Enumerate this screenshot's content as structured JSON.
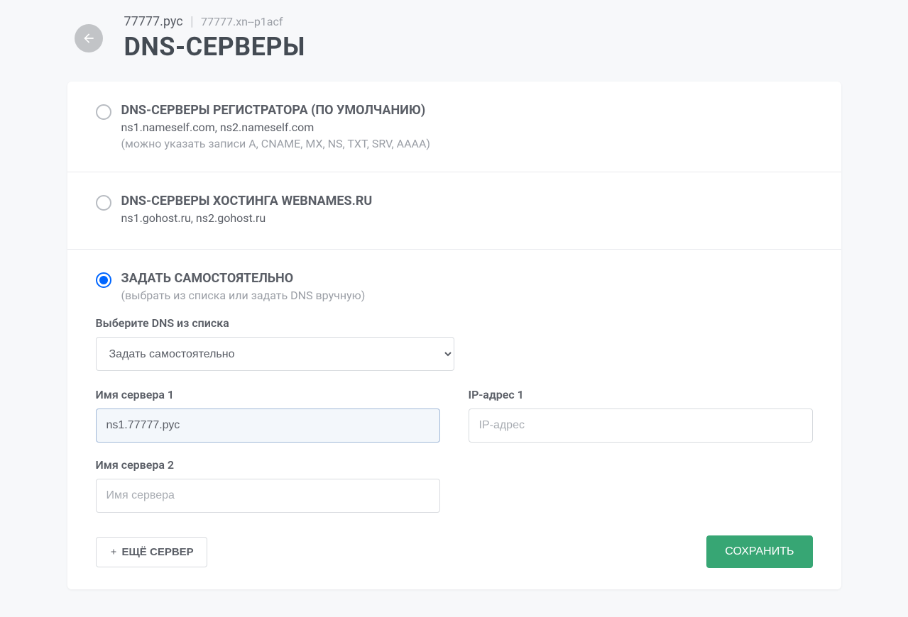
{
  "header": {
    "domain_display": "77777.рус",
    "domain_punycode": "77777.xn--p1acf",
    "page_title": "DNS-СЕРВЕРЫ"
  },
  "options": {
    "registrar": {
      "title": "DNS-СЕРВЕРЫ РЕГИСТРАТОРА (ПО УМОЛЧАНИЮ)",
      "servers": "ns1.nameself.com, ns2.nameself.com",
      "note": "(можно указать записи A, CNAME, MX, NS, TXT, SRV, AAAA)",
      "selected": false
    },
    "hosting": {
      "title": "DNS-СЕРВЕРЫ ХОСТИНГА WEBNAMES.RU",
      "servers": "ns1.gohost.ru, ns2.gohost.ru",
      "selected": false
    },
    "custom": {
      "title": "ЗАДАТЬ САМОСТОЯТЕЛЬНО",
      "note": "(выбрать из списка или задать DNS вручную)",
      "selected": true
    }
  },
  "form": {
    "select_label": "Выберите DNS из списка",
    "select_value": "Задать самостоятельно",
    "server1_label": "Имя сервера 1",
    "server1_value": "ns1.77777.рус",
    "ip1_label": "IP-адрес 1",
    "ip1_placeholder": "IP-адрес",
    "ip1_value": "",
    "server2_label": "Имя сервера 2",
    "server2_placeholder": "Имя сервера",
    "server2_value": ""
  },
  "actions": {
    "add_server": "ЕЩЁ СЕРВЕР",
    "save": "СОХРАНИТЬ"
  }
}
